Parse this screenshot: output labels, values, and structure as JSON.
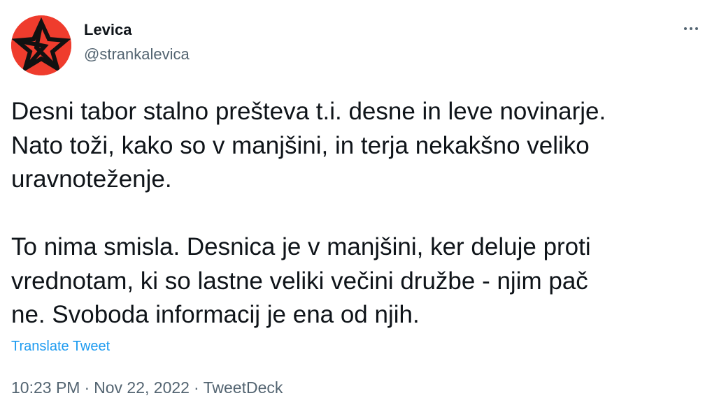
{
  "author": {
    "display_name": "Levica",
    "handle": "@strankalevica",
    "avatar_icon": "red-star-logo-icon",
    "avatar_color": "#ef3c2d"
  },
  "tweet": {
    "paragraphs": [
      [
        "Desni tabor stalno prešteva t.i. desne in leve novinarje.",
        "Nato toži, kako so v manjšini, in terja nekakšno veliko",
        "uravnoteženje."
      ],
      [
        "To nima smisla. Desnica je v manjšini, ker deluje proti",
        "vrednotam, ki so lastne veliki večini družbe - njim pač",
        "ne. Svoboda informacij je ena od njih."
      ]
    ],
    "translate_label": "Translate Tweet",
    "time": "10:23 PM",
    "date": "Nov 22, 2022",
    "source": "TweetDeck",
    "separator": "·"
  },
  "more_icon": "more-options-icon",
  "colors": {
    "link": "#1d9bf0",
    "secondary_text": "#536471",
    "primary_text": "#0f1419"
  }
}
